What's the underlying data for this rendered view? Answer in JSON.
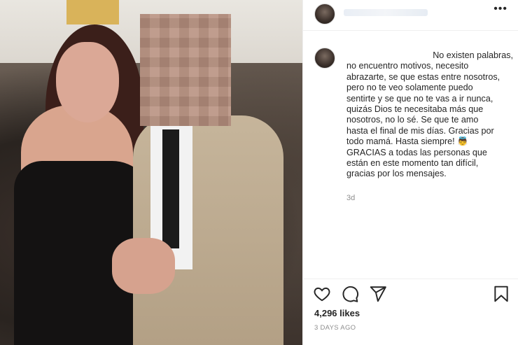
{
  "post": {
    "caption_lines": [
      "No existen palabras,",
      "no encuentro motivos, necesito",
      "abrazarte, se que estas entre nosotros,",
      "pero no te veo solamente puedo",
      "sentirte y se que no te vas a ir nunca,",
      "quizás Dios te necesitaba más que",
      "nosotros, no lo sé. Se que te amo",
      "hasta el final de mis días. Gracias por",
      "todo mamá. Hasta siempre! 👼",
      "GRACIAS a todas las personas que",
      "están en este momento tan difícil,",
      "gracias por los mensajes."
    ],
    "time_ago": "3d",
    "likes": "4,296 likes",
    "date": "3 DAYS AGO",
    "more_label": "•••"
  },
  "icons": {
    "like": "heart-icon",
    "comment": "comment-icon",
    "share": "share-icon",
    "save": "bookmark-icon",
    "more": "more-options-icon"
  }
}
